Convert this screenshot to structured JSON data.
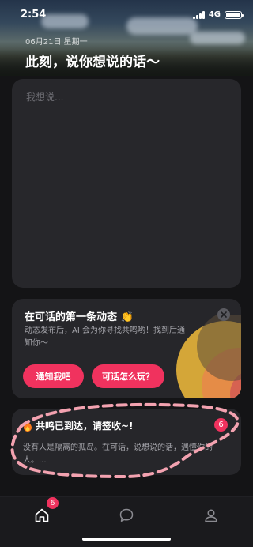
{
  "status_bar": {
    "time": "2:54",
    "network": "4G"
  },
  "header": {
    "date": "06月21日 星期一",
    "headline": "此刻，说你想说的话～"
  },
  "compose": {
    "placeholder": "我想说..."
  },
  "promo": {
    "title": "在可话的第一条动态 👏",
    "description": "动态发布后，AI 会为你寻找共鸣哟！找到后通知你～",
    "notify_button": "通知我吧",
    "howto_button": "可话怎么玩？",
    "close_icon": "close-icon"
  },
  "message": {
    "title": "共鸣已到达，请签收~!",
    "body": "没有人是隔离的孤岛。在可话，说想说的话，遇懂你的人。...",
    "badge": "6",
    "icon": "fire-icon"
  },
  "tabbar": {
    "home_badge": "6",
    "icons": [
      "home-icon",
      "chat-icon",
      "profile-icon"
    ]
  },
  "colors": {
    "accent": "#f0325e",
    "card": "#26262a",
    "background": "#141416"
  }
}
